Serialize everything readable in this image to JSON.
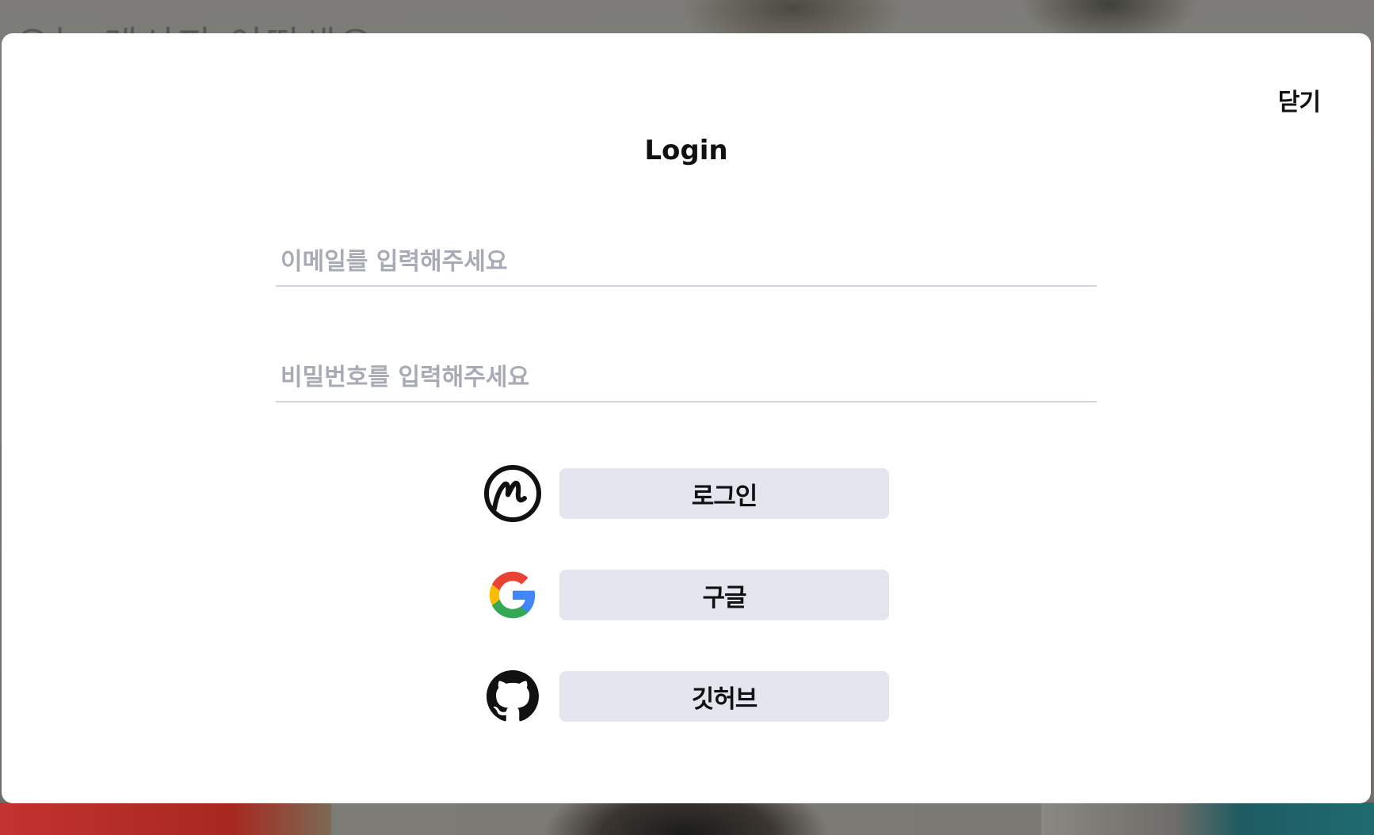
{
  "background": {
    "title": "오늘 레시피 어떠세요"
  },
  "modal": {
    "close_label": "닫기",
    "title": "Login",
    "email": {
      "placeholder": "이메일를 입력해주세요",
      "value": ""
    },
    "password": {
      "placeholder": "비밀번호를 입력해주세요",
      "value": ""
    },
    "auth_buttons": [
      {
        "icon": "coinmarketcap-icon",
        "label": "로그인"
      },
      {
        "icon": "google-icon",
        "label": "구글"
      },
      {
        "icon": "github-icon",
        "label": "깃허브"
      }
    ]
  },
  "colors": {
    "button_bg": "#e3e6ef",
    "placeholder": "#a6abb6",
    "field_border": "#cfd6e3",
    "google_blue": "#4285F4",
    "google_red": "#EA4335",
    "google_yellow": "#FBBC05",
    "google_green": "#34A853"
  }
}
